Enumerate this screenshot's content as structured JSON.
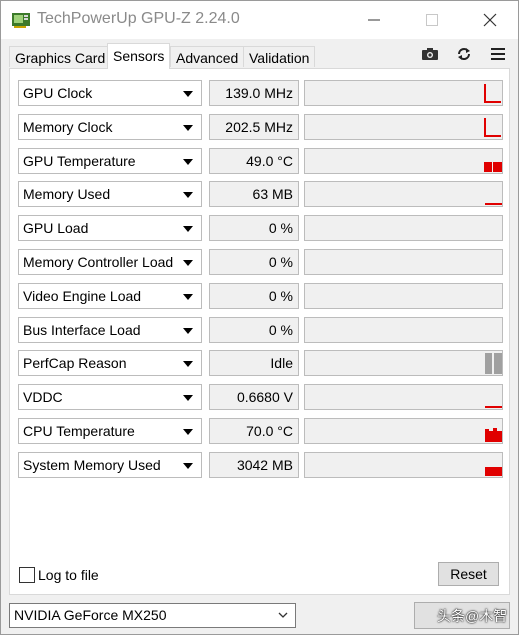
{
  "window": {
    "title": "TechPowerUp GPU-Z 2.24.0",
    "icons": {
      "app": "gpu-card-icon",
      "minimize": "minimize-icon",
      "maximize": "maximize-icon",
      "close": "close-icon"
    }
  },
  "tabs": [
    {
      "label": "Graphics Card",
      "active": false
    },
    {
      "label": "Sensors",
      "active": true
    },
    {
      "label": "Advanced",
      "active": false
    },
    {
      "label": "Validation",
      "active": false
    }
  ],
  "toolbar": {
    "icons": [
      "camera-icon",
      "refresh-icon",
      "menu-icon"
    ]
  },
  "sensors": [
    {
      "label": "GPU Clock",
      "value": "139.0 MHz",
      "graph": "step"
    },
    {
      "label": "Memory Clock",
      "value": "202.5 MHz",
      "graph": "step"
    },
    {
      "label": "GPU Temperature",
      "value": "49.0 °C",
      "graph": "blocks"
    },
    {
      "label": "Memory Used",
      "value": "63 MB",
      "graph": "line-low"
    },
    {
      "label": "GPU Load",
      "value": "0 %",
      "graph": "none"
    },
    {
      "label": "Memory Controller Load",
      "value": "0 %",
      "graph": "none"
    },
    {
      "label": "Video Engine Load",
      "value": "0 %",
      "graph": "none"
    },
    {
      "label": "Bus Interface Load",
      "value": "0 %",
      "graph": "none"
    },
    {
      "label": "PerfCap Reason",
      "value": "Idle",
      "graph": "perfcap"
    },
    {
      "label": "VDDC",
      "value": "0.6680 V",
      "graph": "line-low"
    },
    {
      "label": "CPU Temperature",
      "value": "70.0 °C",
      "graph": "cpu-temp"
    },
    {
      "label": "System Memory Used",
      "value": "3042 MB",
      "graph": "sysmem"
    }
  ],
  "footer": {
    "log_to_file_label": "Log to file",
    "log_to_file_checked": false,
    "reset_label": "Reset",
    "gpu_selected": "NVIDIA GeForce MX250",
    "watermark": "头条@木智"
  },
  "colors": {
    "graph_red": "#e00000",
    "graph_gray": "#a0a0a0"
  }
}
